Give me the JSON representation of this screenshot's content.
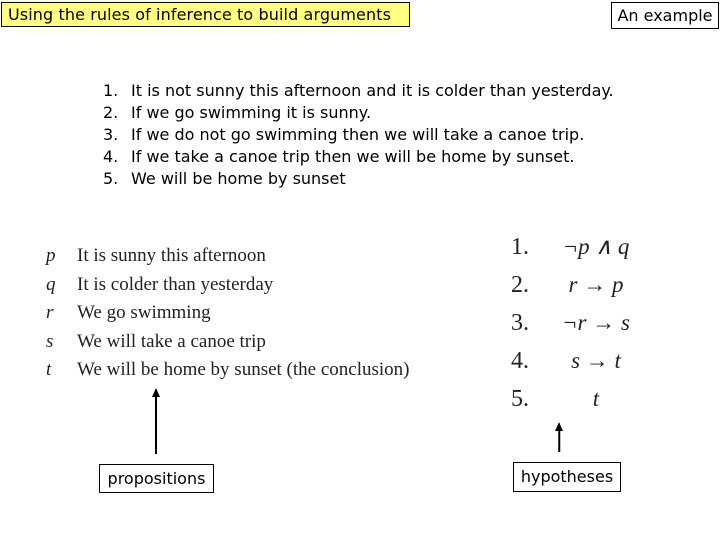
{
  "header": {
    "title": "Using the rules of inference to build arguments",
    "badge": "An example",
    "title_bg_color": "#ffff80"
  },
  "premises": [
    {
      "num": "1.",
      "text": "It is not sunny this afternoon and it is colder than yesterday."
    },
    {
      "num": "2.",
      "text": "If we go swimming it is sunny."
    },
    {
      "num": "3.",
      "text": "If we do not go swimming then we will take a canoe trip."
    },
    {
      "num": "4.",
      "text": "If we take a canoe trip then we will be home by sunset."
    },
    {
      "num": "5.",
      "text": "We will be home by sunset"
    }
  ],
  "propositions": [
    {
      "var": "p",
      "text": "It is sunny this afternoon"
    },
    {
      "var": "q",
      "text": "It is colder than yesterday"
    },
    {
      "var": "r",
      "text": "We go swimming"
    },
    {
      "var": "s",
      "text": "We will take a canoe trip"
    },
    {
      "var": "t",
      "text": "We will be home by sunset (the conclusion)"
    }
  ],
  "hypotheses": [
    {
      "num": "1.",
      "expr": "¬p ∧ q"
    },
    {
      "num": "2.",
      "expr": "r → p"
    },
    {
      "num": "3.",
      "expr": "¬r → s"
    },
    {
      "num": "4.",
      "expr": "s → t"
    },
    {
      "num": "5.",
      "expr": "t"
    }
  ],
  "labels": {
    "propositions": "propositions",
    "hypotheses": "hypotheses"
  }
}
